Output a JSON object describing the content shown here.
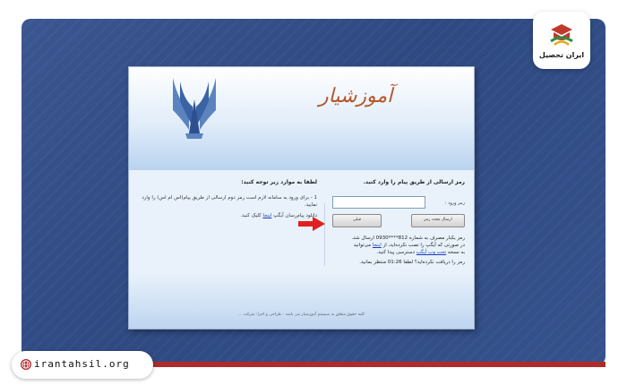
{
  "brand": {
    "name": "ایران تحصیل",
    "website": "irantahsil.org"
  },
  "login_window": {
    "system_title": "آموزشیار",
    "instructions": {
      "title": "لطفا به موارد زیر توجه کنید:",
      "item_1": "1 - برای ورود به سامانه لازم است رمز دوم ارسالی از طریق پیام(اس ام اس) را وارد نمایید.",
      "item_2_prefix": "دانلود پیام‌رسان آیگپ",
      "item_2_link": "اینجا",
      "item_2_suffix": "کلیک کنید."
    },
    "login_form": {
      "title": "رمز ارسالی از طریق پیام را وارد کنید.",
      "username_label": "رمز ورود :",
      "username_value": "",
      "send_code_button": "ارسال مجدد رمز",
      "back_button": "قبلی",
      "sms_info_line1": "رمز یکبار مصرف به شماره 812****0930 ارسال شد.",
      "sms_info_line2_prefix": "در صورتی که آیگپ را نصب نکرده‌اید، از",
      "sms_info_line2_link": "اینجا",
      "sms_info_line2_suffix": "می‌توانید",
      "sms_info_line3_prefix": "به نسخه",
      "sms_info_line3_link": "تحت وب آیگپ",
      "sms_info_line3_suffix": "دسترسی پیدا کنید.",
      "retry_info": "رمز را دریافت نکرده‌اید؟ لطفا 01:26 منتظر بمانید."
    },
    "footer": "کلیه حقوق متعلق به سیستم آموزشیار می باشد - طراحی و اجرا: شرکت ..."
  },
  "colors": {
    "background": "#2f4a82",
    "accent_red": "#b02a2a",
    "title_orange": "#b5562b",
    "arrow_red": "#e02020"
  }
}
